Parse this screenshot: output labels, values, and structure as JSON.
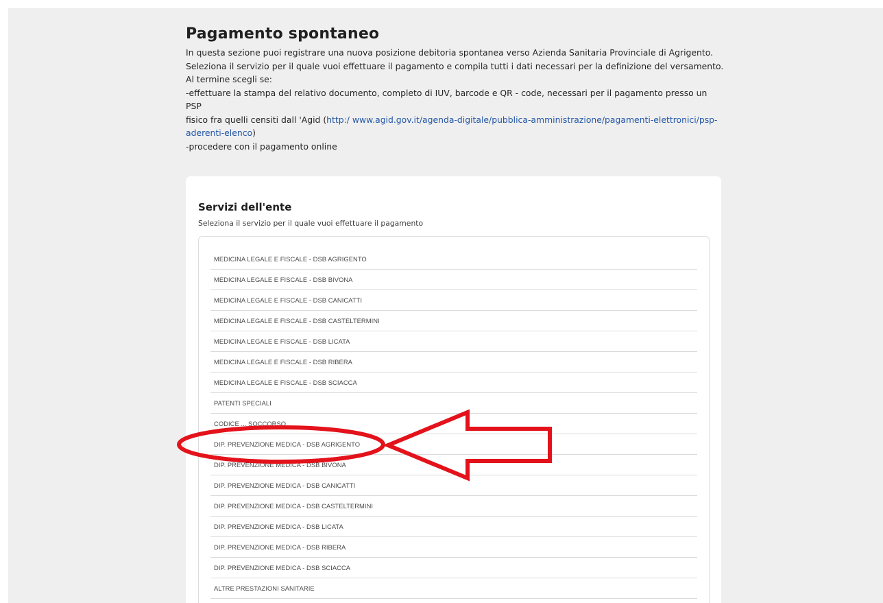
{
  "header": {
    "title": "Pagamento spontaneo",
    "description_lines": [
      "In questa sezione puoi registrare una nuova posizione debitoria spontanea verso Azienda Sanitaria Provinciale di Agrigento.",
      "Seleziona il servizio per il quale vuoi effettuare il pagamento e compila tutti i dati necessari per la definizione del versamento.",
      "Al termine scegli se:",
      "-effettuare la stampa del relativo documento, completo di IUV, barcode e QR - code, necessari per il pagamento presso un PSP"
    ],
    "psp_text_before": "fisico fra quelli censiti dall 'Agid (",
    "psp_link": "http:/ www.agid.gov.it/agenda-digitale/pubblica-amministrazione/pagamenti-elettronici/psp-aderenti-elenco",
    "psp_text_after": ")",
    "online_option": "-procedere con il pagamento online"
  },
  "services": {
    "title": "Servizi dell'ente",
    "subtitle": "Seleziona il servizio per il quale vuoi effettuare il pagamento",
    "items": [
      "MEDICINA LEGALE E FISCALE - DSB AGRIGENTO",
      "MEDICINA LEGALE E FISCALE - DSB BIVONA",
      "MEDICINA LEGALE E FISCALE - DSB CANICATTI",
      "MEDICINA LEGALE E FISCALE - DSB CASTELTERMINI",
      "MEDICINA LEGALE E FISCALE - DSB LICATA",
      "MEDICINA LEGALE E FISCALE - DSB RIBERA",
      "MEDICINA LEGALE E FISCALE - DSB SCIACCA",
      "PATENTI SPECIALI",
      "CODICE ... SOCCORSO",
      "DIP. PREVENZIONE MEDICA - DSB AGRIGENTO",
      "DIP. PREVENZIONE MEDICA - DSB BIVONA",
      "DIP. PREVENZIONE MEDICA - DSB CANICATTI",
      "DIP. PREVENZIONE MEDICA - DSB CASTELTERMINI",
      "DIP. PREVENZIONE MEDICA - DSB LICATA",
      "DIP. PREVENZIONE MEDICA - DSB RIBERA",
      "DIP. PREVENZIONE MEDICA - DSB SCIACCA",
      "ALTRE PRESTAZIONI SANITARIE"
    ]
  },
  "annotation": {
    "highlight_color": "#e3121b",
    "icon": "arrow-left-outline-icon"
  }
}
